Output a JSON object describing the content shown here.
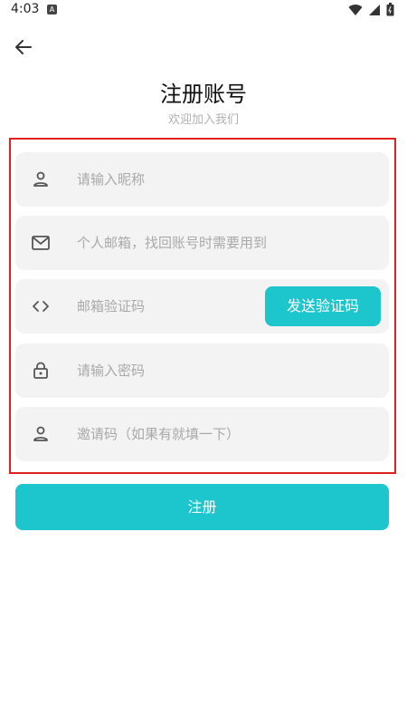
{
  "status_bar": {
    "time": "4:03",
    "notification_icon": "app-notification-icon",
    "icons": [
      "wifi-icon",
      "signal-icon",
      "battery-icon"
    ]
  },
  "header": {
    "back_icon": "arrow-left-icon",
    "title": "注册账号",
    "subtitle": "欢迎加入我们"
  },
  "form": {
    "nickname": {
      "icon": "person-icon",
      "placeholder": "请输入昵称",
      "value": ""
    },
    "email": {
      "icon": "mail-icon",
      "placeholder": "个人邮箱，找回账号时需要用到",
      "value": ""
    },
    "code": {
      "icon": "code-brackets-icon",
      "placeholder": "邮箱验证码",
      "value": "",
      "send_label": "发送验证码"
    },
    "password": {
      "icon": "lock-icon",
      "placeholder": "请输入密码",
      "value": ""
    },
    "invite": {
      "icon": "person-icon",
      "placeholder": "邀请码（如果有就填一下）",
      "value": ""
    }
  },
  "submit_label": "注册",
  "colors": {
    "accent": "#1cc6cc",
    "field_bg": "#f3f3f3",
    "highlight_frame": "#e0211d"
  }
}
